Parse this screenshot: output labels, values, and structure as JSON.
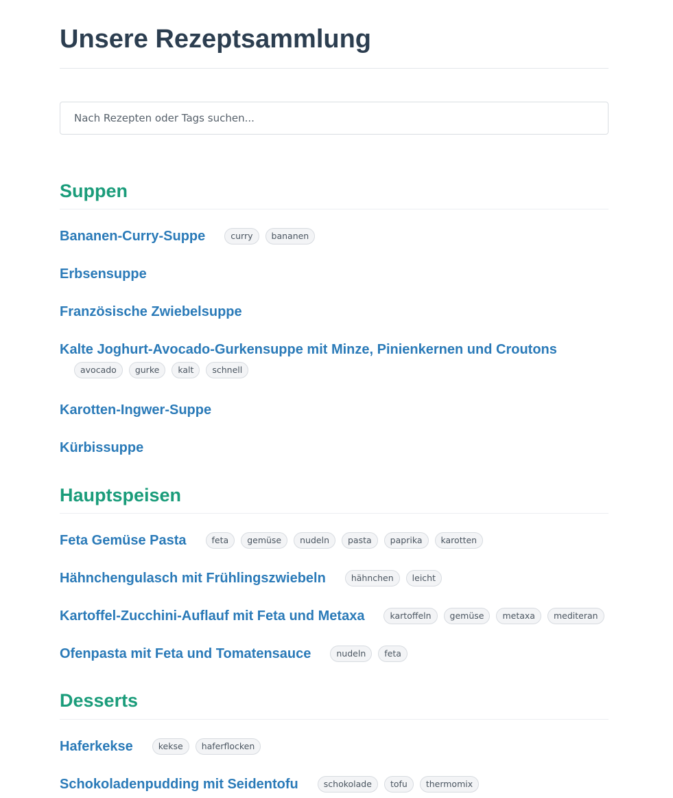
{
  "page": {
    "title": "Unsere Rezeptsammlung"
  },
  "search": {
    "placeholder": "Nach Rezepten oder Tags suchen...",
    "value": ""
  },
  "sections": [
    {
      "title": "Suppen",
      "recipes": [
        {
          "name": "Bananen-Curry-Suppe",
          "tags": [
            "curry",
            "bananen"
          ]
        },
        {
          "name": "Erbsensuppe",
          "tags": []
        },
        {
          "name": "Französische Zwiebelsuppe",
          "tags": []
        },
        {
          "name": "Kalte Joghurt-Avocado-Gurkensuppe mit Minze, Pinienkernen und Croutons",
          "tags": [
            "avocado",
            "gurke",
            "kalt",
            "schnell"
          ]
        },
        {
          "name": "Karotten-Ingwer-Suppe",
          "tags": []
        },
        {
          "name": "Kürbissuppe",
          "tags": []
        }
      ]
    },
    {
      "title": "Hauptspeisen",
      "recipes": [
        {
          "name": "Feta Gemüse Pasta",
          "tags": [
            "feta",
            "gemüse",
            "nudeln",
            "pasta",
            "paprika",
            "karotten"
          ]
        },
        {
          "name": "Hähnchengulasch mit Frühlingszwiebeln",
          "tags": [
            "hähnchen",
            "leicht"
          ]
        },
        {
          "name": "Kartoffel-Zucchini-Auflauf mit Feta und Metaxa",
          "tags": [
            "kartoffeln",
            "gemüse",
            "metaxa",
            "mediteran"
          ]
        },
        {
          "name": "Ofenpasta mit Feta und Tomatensauce",
          "tags": [
            "nudeln",
            "feta"
          ]
        }
      ]
    },
    {
      "title": "Desserts",
      "recipes": [
        {
          "name": "Haferkekse",
          "tags": [
            "kekse",
            "haferflocken"
          ]
        },
        {
          "name": "Schokoladenpudding mit Seidentofu",
          "tags": [
            "schokolade",
            "tofu",
            "thermomix"
          ]
        }
      ]
    }
  ],
  "colors": {
    "title": "#2c3e50",
    "section_heading": "#1a9c7a",
    "recipe_link": "#2a7ab8",
    "tag_background": "#f3f4f6"
  }
}
